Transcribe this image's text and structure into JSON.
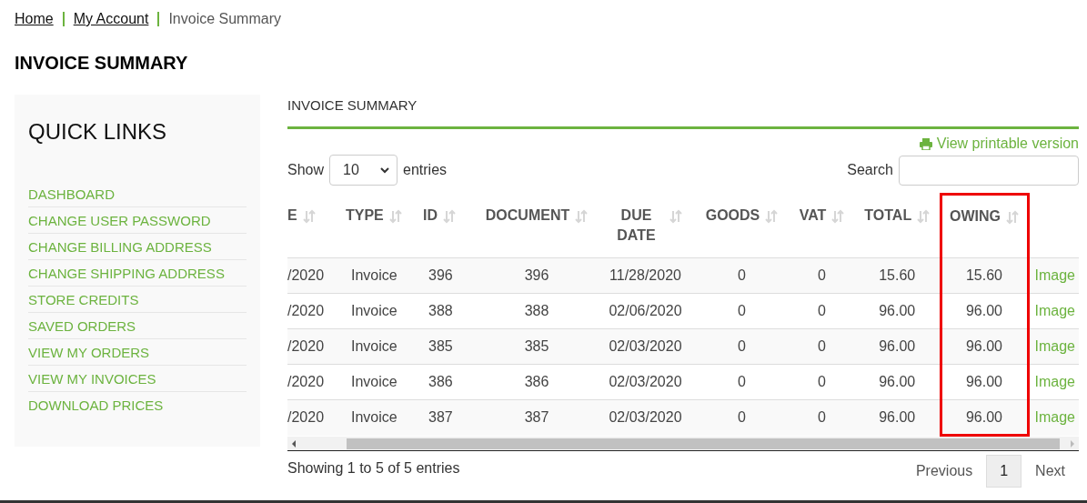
{
  "breadcrumb": [
    {
      "label": "Home",
      "kind": "link"
    },
    {
      "label": "My Account",
      "kind": "link"
    },
    {
      "label": "Invoice Summary",
      "kind": "current"
    }
  ],
  "page_title": "INVOICE SUMMARY",
  "sidebar": {
    "title": "QUICK LINKS",
    "items": [
      "DASHBOARD",
      "CHANGE USER PASSWORD",
      "CHANGE BILLING ADDRESS",
      "CHANGE SHIPPING ADDRESS",
      "STORE CREDITS",
      "SAVED ORDERS",
      "VIEW MY ORDERS",
      "VIEW MY INVOICES",
      "DOWNLOAD PRICES"
    ]
  },
  "section_title": "INVOICE SUMMARY",
  "print_link": "View printable version",
  "length_control": {
    "label_before": "Show",
    "value": "10",
    "label_after": "entries"
  },
  "search": {
    "label": "Search"
  },
  "table": {
    "columns": [
      {
        "label": "E",
        "highlighted": false
      },
      {
        "label": "TYPE",
        "highlighted": false
      },
      {
        "label": "ID",
        "highlighted": false
      },
      {
        "label": "DOCUMENT",
        "highlighted": false
      },
      {
        "label": "DUE DATE",
        "highlighted": false
      },
      {
        "label": "GOODS",
        "highlighted": false
      },
      {
        "label": "VAT",
        "highlighted": false
      },
      {
        "label": "TOTAL",
        "highlighted": false
      },
      {
        "label": "OWING",
        "highlighted": true
      },
      {
        "highlighted": false
      }
    ],
    "rows": [
      [
        "/2020",
        "Invoice",
        "396",
        "396",
        "11/28/2020",
        "0",
        "0",
        "15.60",
        "15.60",
        "Image"
      ],
      [
        "/2020",
        "Invoice",
        "388",
        "388",
        "02/06/2020",
        "0",
        "0",
        "96.00",
        "96.00",
        "Image"
      ],
      [
        "/2020",
        "Invoice",
        "385",
        "385",
        "02/03/2020",
        "0",
        "0",
        "96.00",
        "96.00",
        "Image"
      ],
      [
        "/2020",
        "Invoice",
        "386",
        "386",
        "02/03/2020",
        "0",
        "0",
        "96.00",
        "96.00",
        "Image"
      ],
      [
        "/2020",
        "Invoice",
        "387",
        "387",
        "02/03/2020",
        "0",
        "0",
        "96.00",
        "96.00",
        "Image"
      ]
    ]
  },
  "info": "Showing 1 to 5 of 5 entries",
  "pagination": [
    {
      "label": "Previous",
      "selected": false
    },
    {
      "label": "1",
      "selected": true
    },
    {
      "label": "Next",
      "selected": false
    }
  ]
}
